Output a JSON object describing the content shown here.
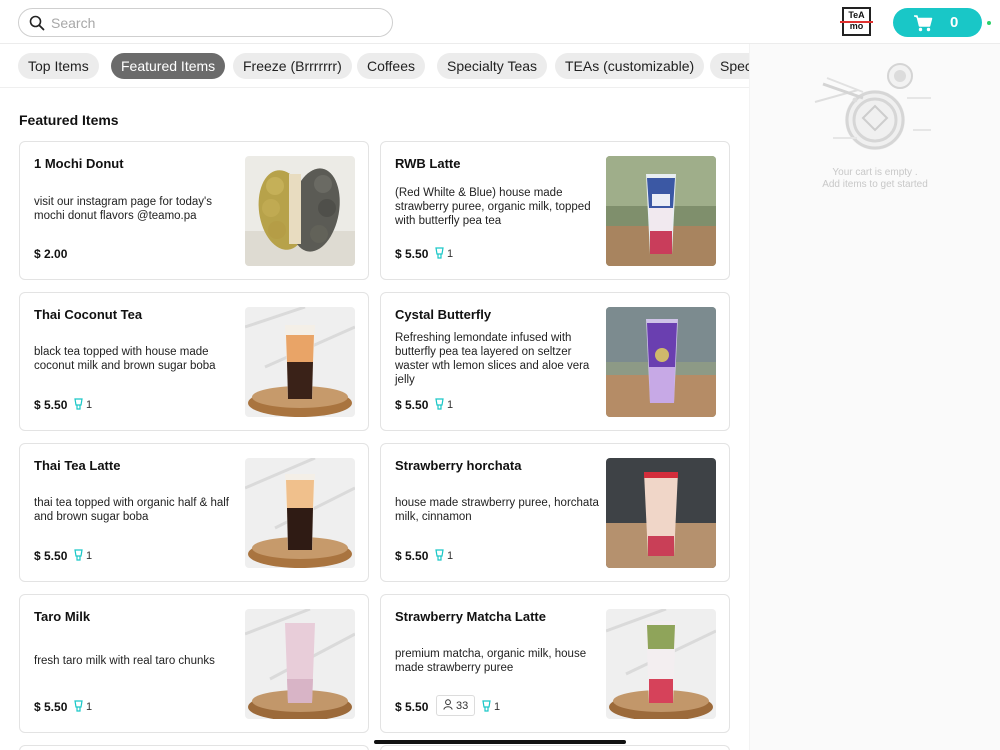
{
  "search": {
    "placeholder": "Search",
    "icon": "search-icon"
  },
  "brand": {
    "logo_top": "TeA",
    "logo_bottom": "mo"
  },
  "cart": {
    "count": "0",
    "color": "#19c7c7",
    "empty_line1": "Your cart is empty .",
    "empty_line2": "Add items to get started"
  },
  "tabs": [
    {
      "label": "Top Items",
      "active": false
    },
    {
      "label": "Featured Items",
      "active": true
    },
    {
      "label": "Freeze (Brrrrrrr)",
      "active": false
    },
    {
      "label": "Coffees",
      "active": false
    },
    {
      "label": "Specialty Teas",
      "active": false
    },
    {
      "label": "TEAs (customizable)",
      "active": false
    },
    {
      "label": "Spec",
      "active": false
    }
  ],
  "section": {
    "title": "Featured Items"
  },
  "items": [
    {
      "name": "1 Mochi Donut",
      "desc": "visit our instagram page for today's mochi donut flavors @teamo.pa",
      "price": "$ 2.00",
      "likes": ""
    },
    {
      "name": "RWB Latte",
      "desc": "(Red Whilte & Blue) house made strawberry puree, organic milk, topped with butterfly pea tea",
      "price": "$ 5.50",
      "likes": "1"
    },
    {
      "name": "Thai Coconut Tea",
      "desc": "black tea topped with house made coconut milk and brown sugar boba",
      "price": "$ 5.50",
      "likes": "1"
    },
    {
      "name": "Cystal Butterfly",
      "desc": "Refreshing lemondate infused with butterfly pea tea layered on seltzer waster wth lemon slices and aloe vera jelly",
      "price": "$ 5.50",
      "likes": "1"
    },
    {
      "name": "Thai Tea Latte",
      "desc": "thai tea topped with organic half & half and brown sugar boba",
      "price": "$ 5.50",
      "likes": "1"
    },
    {
      "name": "Strawberry horchata",
      "desc": "house made strawberry puree, horchata milk, cinnamon",
      "price": "$ 5.50",
      "likes": "1"
    },
    {
      "name": "Taro Milk",
      "desc": "fresh taro milk with real taro chunks",
      "price": "$ 5.50",
      "likes": "1"
    },
    {
      "name": "Strawberry Matcha Latte",
      "desc": "premium matcha, organic milk, house made strawberry puree",
      "price": "$ 5.50",
      "likes": "1",
      "people": "33"
    }
  ]
}
